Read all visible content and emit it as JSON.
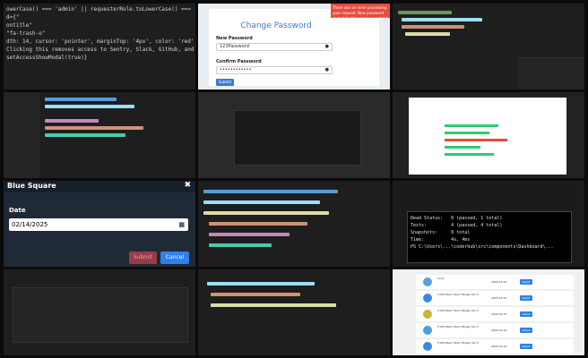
{
  "tiles": {
    "code1": {
      "lines": [
        "owerCase() === 'admin' || requesterRole.toLowerCase() === 'owner') && (",
        "d={\"",
        "",
        "ontitle\"",
        "\"fa-trash-o\"",
        "",
        "dth: 14, cursor: 'pointer', marginTop: '4px', color: 'red' }}",
        "Clicking this removes access to Sentry, Slack, GitHub, and deletes al",
        "setAccessShowModal(true)}"
      ]
    },
    "password": {
      "title": "Change Password",
      "new_label": "New Password",
      "new_value": "123Password",
      "confirm_label": "Confirm Password",
      "confirm_value": "••••••••••••",
      "submit": "Submit",
      "toast": "There was an error processing your request. New password cannot be the same as current password.",
      "eye_icon": "eye-icon"
    },
    "modal": {
      "title": "Blue Square",
      "close": "✖",
      "date_label": "Date",
      "date_value": "02/14/2025",
      "submit": "Submit",
      "cancel": "Cancel",
      "calendar_icon": "calendar-icon"
    },
    "terminal": {
      "lines": [
        "Dead Status:   0 (passed, 1 total)",
        "Tests:         4 (passed, 4 total)",
        "Snapshots:     0 total",
        "Time:          4s, 4ms",
        "PS C:\\Users\\...\\coderhub\\src\\components\\Dashboard\\..."
      ]
    },
    "list": {
      "items": [
        {
          "title": "Cyan",
          "date": "2025-01-01",
          "btn": "Select",
          "color": "#5aa0e0"
        },
        {
          "title": "T-050-Team Team Badge Tier 2",
          "date": "2025-01-01",
          "btn": "Select",
          "color": "#3a8ad8"
        },
        {
          "title": "T-050-Team Team Badge Tier 2",
          "date": "2025-01-01",
          "btn": "Select",
          "color": "#c8b436"
        },
        {
          "title": "T-050-Team Team Badge Tier 2",
          "date": "2025-01-01",
          "btn": "Select",
          "color": "#4aa0d8"
        },
        {
          "title": "T-050-Team Team Badge Tier 2",
          "date": "2025-01-01",
          "btn": "Select",
          "color": "#3a8ad8"
        }
      ]
    }
  },
  "colors": {
    "accent": "#2f80ed",
    "danger": "#e74c3c",
    "editor_bg": "#1e1e1e"
  }
}
